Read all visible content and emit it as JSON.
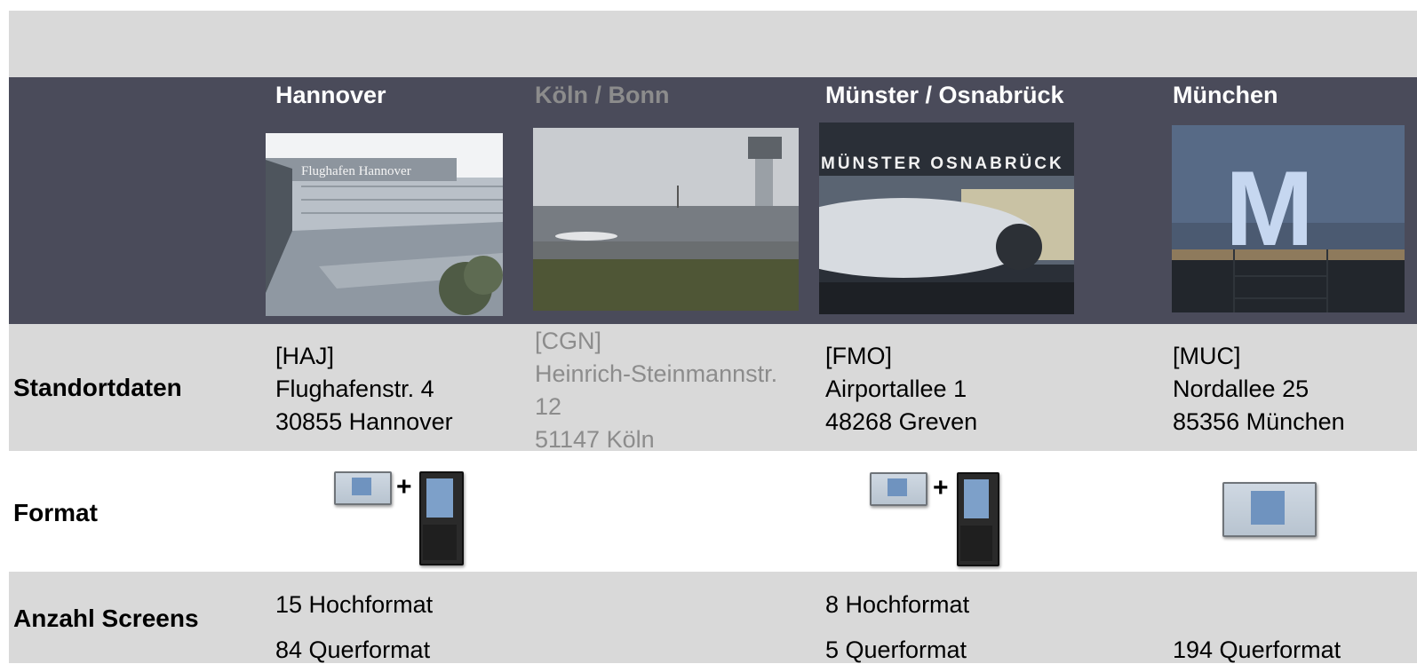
{
  "columns": [
    {
      "name": "Hannover",
      "code": "[HAJ]",
      "address": [
        "Flughafenstr. 4",
        "30855 Hannover"
      ],
      "counts": [
        "15 Hochformat",
        "84 Querformat"
      ]
    },
    {
      "name": "Köln / Bonn",
      "code": "[CGN]",
      "address": [
        "Heinrich-Steinmannstr.",
        "12",
        "51147 Köln"
      ],
      "counts": []
    },
    {
      "name": "Münster / Osnabrück",
      "code": "[FMO]",
      "address": [
        "Airportallee 1",
        "48268 Greven"
      ],
      "counts": [
        "8 Hochformat",
        "5 Querformat"
      ]
    },
    {
      "name": "München",
      "code": "[MUC]",
      "address": [
        "Nordallee 25",
        "85356 München"
      ],
      "counts": [
        "194 Querformat"
      ]
    }
  ],
  "rows": {
    "standort": "Standortdaten",
    "format": "Format",
    "anzahl": "Anzahl Screens"
  },
  "photos": {
    "hannover_sign": "Flughafen Hannover",
    "muenster_sign": "MÜNSTER OSNABRÜCK",
    "muenchen_letter": "M"
  },
  "format_plus": "+",
  "colors": {
    "header_band": "#4a4b5a",
    "grey_band": "#d9d9d9",
    "dim_text": "#8c8c8c"
  }
}
